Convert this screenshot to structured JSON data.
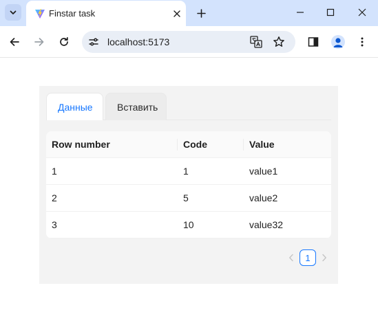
{
  "browser": {
    "tab_title": "Finstar task",
    "url": "localhost:5173"
  },
  "page": {
    "tabs": [
      {
        "label": "Данные",
        "active": true
      },
      {
        "label": "Вставить",
        "active": false
      }
    ],
    "table": {
      "columns": [
        "Row number",
        "Code",
        "Value"
      ],
      "rows": [
        [
          "1",
          "1",
          "value1"
        ],
        [
          "2",
          "5",
          "value2"
        ],
        [
          "3",
          "10",
          "value32"
        ]
      ]
    },
    "pagination": {
      "current_page": "1"
    }
  },
  "colors": {
    "accent": "#1677ff",
    "tabstrip": "#d3e3fd",
    "panel": "#f3f3f3"
  },
  "icons": {
    "tab_search": "chevron-down-icon",
    "favicon": "vite-logo-icon",
    "tab_close": "close-icon",
    "new_tab": "plus-icon",
    "back": "arrow-left-icon",
    "forward": "arrow-right-icon",
    "reload": "reload-icon",
    "site_info": "tune-icon",
    "translate": "translate-icon",
    "bookmark": "star-icon",
    "side_panel": "side-panel-icon",
    "profile": "profile-icon",
    "menu": "kebab-menu-icon",
    "prev_page": "chevron-left-icon",
    "next_page": "chevron-right-icon"
  }
}
